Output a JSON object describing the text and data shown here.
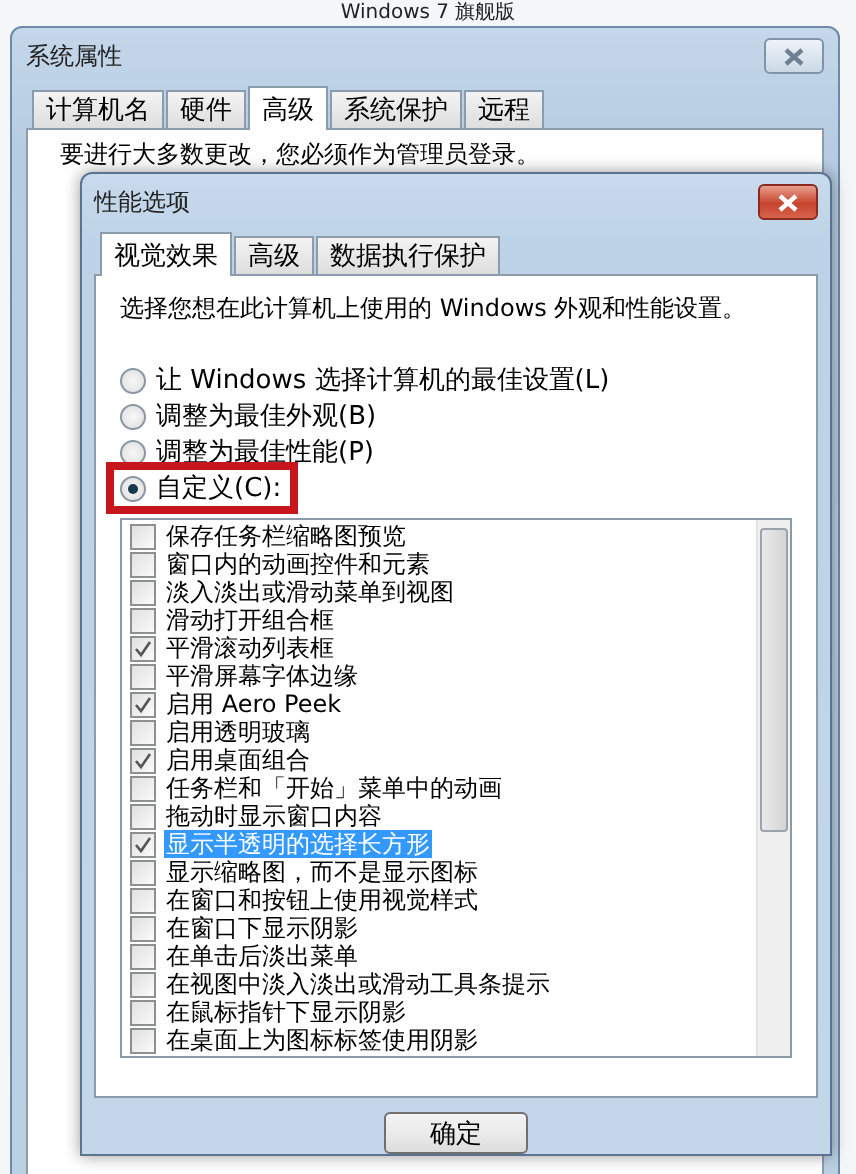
{
  "desktop_title": "Windows 7 旗舰版",
  "window": {
    "title": "系统属性",
    "notice": "要进行大多数更改，您必须作为管理员登录。"
  },
  "tabs": [
    {
      "label": "计算机名",
      "selected": false
    },
    {
      "label": "硬件",
      "selected": false
    },
    {
      "label": "高级",
      "selected": true
    },
    {
      "label": "系统保护",
      "selected": false
    },
    {
      "label": "远程",
      "selected": false
    }
  ],
  "dialog": {
    "title": "性能选项",
    "tabs": [
      {
        "label": "视觉效果",
        "selected": true
      },
      {
        "label": "高级",
        "selected": false
      },
      {
        "label": "数据执行保护",
        "selected": false
      }
    ],
    "description": "选择您想在此计算机上使用的 Windows 外观和性能设置。",
    "options": [
      {
        "label": "让 Windows 选择计算机的最佳设置(L)",
        "selected": false,
        "highlighted": false
      },
      {
        "label": "调整为最佳外观(B)",
        "selected": false,
        "highlighted": false
      },
      {
        "label": "调整为最佳性能(P)",
        "selected": false,
        "highlighted": false
      },
      {
        "label": "自定义(C):",
        "selected": true,
        "highlighted": true
      }
    ],
    "effects": [
      {
        "label": "保存任务栏缩略图预览",
        "checked": false,
        "selected": false
      },
      {
        "label": "窗口内的动画控件和元素",
        "checked": false,
        "selected": false
      },
      {
        "label": "淡入淡出或滑动菜单到视图",
        "checked": false,
        "selected": false
      },
      {
        "label": "滑动打开组合框",
        "checked": false,
        "selected": false
      },
      {
        "label": "平滑滚动列表框",
        "checked": true,
        "selected": false
      },
      {
        "label": "平滑屏幕字体边缘",
        "checked": false,
        "selected": false
      },
      {
        "label": "启用 Aero Peek",
        "checked": true,
        "selected": false
      },
      {
        "label": "启用透明玻璃",
        "checked": false,
        "selected": false
      },
      {
        "label": "启用桌面组合",
        "checked": true,
        "selected": false
      },
      {
        "label": "任务栏和「开始」菜单中的动画",
        "checked": false,
        "selected": false
      },
      {
        "label": "拖动时显示窗口内容",
        "checked": false,
        "selected": false
      },
      {
        "label": "显示半透明的选择长方形",
        "checked": true,
        "selected": true
      },
      {
        "label": "显示缩略图，而不是显示图标",
        "checked": false,
        "selected": false
      },
      {
        "label": "在窗口和按钮上使用视觉样式",
        "checked": false,
        "selected": false
      },
      {
        "label": "在窗口下显示阴影",
        "checked": false,
        "selected": false
      },
      {
        "label": "在单击后淡出菜单",
        "checked": false,
        "selected": false
      },
      {
        "label": "在视图中淡入淡出或滑动工具条提示",
        "checked": false,
        "selected": false
      },
      {
        "label": "在鼠标指针下显示阴影",
        "checked": false,
        "selected": false
      },
      {
        "label": "在桌面上为图标标签使用阴影",
        "checked": false,
        "selected": false
      }
    ],
    "ok_button": "确定"
  }
}
